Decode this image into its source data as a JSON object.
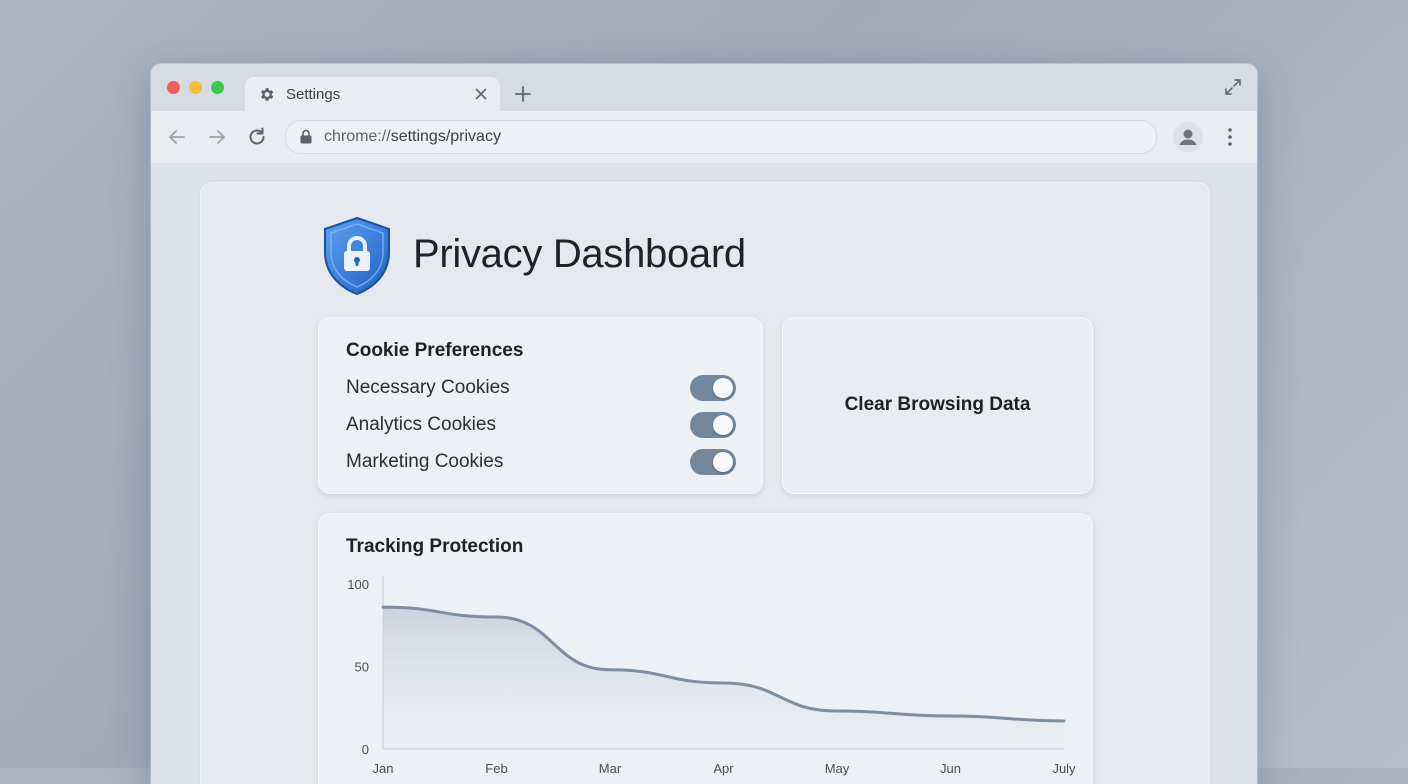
{
  "browser": {
    "tab_title": "Settings",
    "url_scheme": "chrome://",
    "url_path": "settings/privacy",
    "icons": [
      "gear-icon",
      "close-icon",
      "plus-icon",
      "expand-icon",
      "back-icon",
      "forward-icon",
      "reload-icon",
      "lock-icon",
      "profile-icon",
      "more-icon"
    ]
  },
  "page": {
    "title": "Privacy Dashboard",
    "accent_color": "#2f7ae0",
    "logo_icon": "shield-lock-icon"
  },
  "cookies": {
    "title": "Cookie Preferences",
    "items": [
      {
        "label": "Necessary Cookies",
        "on": true
      },
      {
        "label": "Analytics Cookies",
        "on": true
      },
      {
        "label": "Marketing Cookies",
        "on": true
      }
    ],
    "toggle_color": "#72869c"
  },
  "actions": {
    "clear_label": "Clear Browsing Data"
  },
  "tracking": {
    "title": "Tracking Protection"
  },
  "chart_data": {
    "type": "area",
    "title": "Tracking Protection",
    "categories": [
      "Jan",
      "Feb",
      "Mar",
      "Apr",
      "May",
      "Jun",
      "July"
    ],
    "values": [
      86,
      80,
      48,
      40,
      23,
      20,
      17
    ],
    "ylim": [
      0,
      100
    ],
    "yticks": [
      0,
      50,
      100
    ],
    "line_color": "#7d8ea3",
    "grid": false
  }
}
